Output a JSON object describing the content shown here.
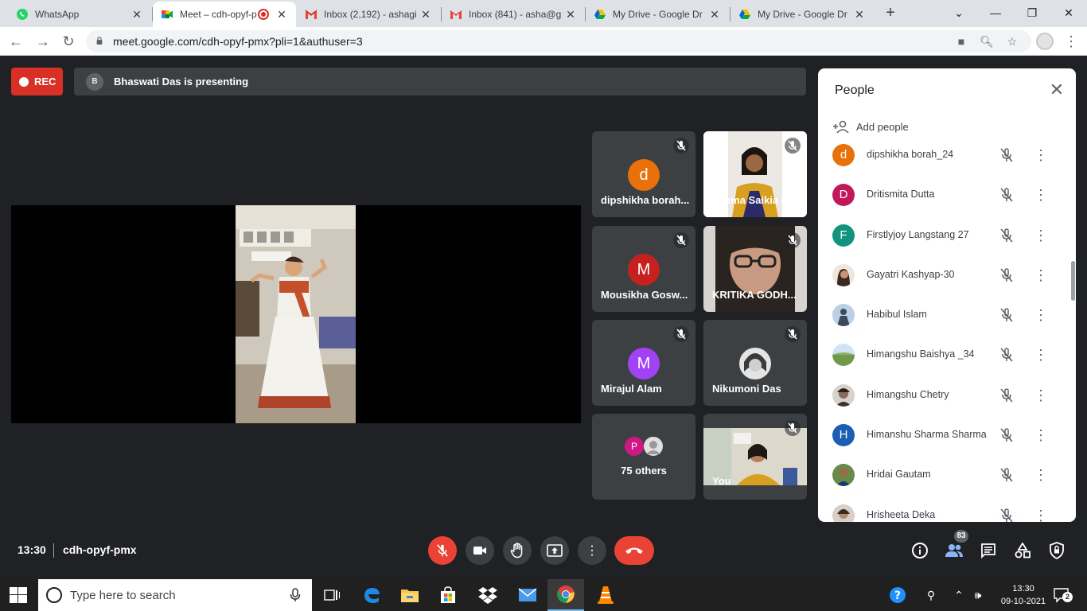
{
  "browser": {
    "tabs": [
      {
        "title": "WhatsApp",
        "icon": "whatsapp-icon"
      },
      {
        "title": "Meet – cdh-opyf-p",
        "icon": "google-meet-icon",
        "recording": true
      },
      {
        "title": "Inbox (2,192) - ashagi",
        "icon": "gmail-icon"
      },
      {
        "title": "Inbox (841) - asha@g",
        "icon": "gmail-icon"
      },
      {
        "title": "My Drive - Google Dr",
        "icon": "google-drive-icon"
      },
      {
        "title": "My Drive - Google Dr",
        "icon": "google-drive-icon"
      }
    ],
    "url": "meet.google.com/cdh-opyf-pmx?pli=1&authuser=3"
  },
  "meet": {
    "rec_label": "REC",
    "presenter": {
      "initial": "B",
      "text": "Bhaswati Das is presenting"
    },
    "tiles": [
      {
        "name": "dipshikha borah...",
        "initial": "d",
        "color": "#e8710a",
        "type": "avatar"
      },
      {
        "name": "Seema Saikia 84",
        "type": "video"
      },
      {
        "name": "Mousikha Gosw...",
        "initial": "M",
        "color": "#c5221f",
        "type": "avatar"
      },
      {
        "name": "KRITIKA GODH...",
        "type": "video"
      },
      {
        "name": "Mirajul Alam",
        "initial": "M",
        "color": "#a142f4",
        "type": "avatar"
      },
      {
        "name": "Nikumoni Das",
        "type": "photo"
      },
      {
        "name": "75 others",
        "initial": "P",
        "color": "#d01884",
        "type": "others"
      },
      {
        "name": "You",
        "type": "video"
      }
    ],
    "meeting_time": "13:30",
    "meeting_code": "cdh-opyf-pmx",
    "participant_count": "83"
  },
  "people_panel": {
    "title": "People",
    "add_label": "Add people",
    "people": [
      {
        "name": "dipshikha borah_24",
        "initial": "d",
        "color": "#e8710a"
      },
      {
        "name": "Dritismita Dutta",
        "initial": "D",
        "color": "#c2185b"
      },
      {
        "name": "Firstlyjoy Langstang 27",
        "initial": "F",
        "color": "#12937b"
      },
      {
        "name": "Gayatri Kashyap-30",
        "initial": "",
        "color": "#b08d7a"
      },
      {
        "name": "Habibul Islam",
        "initial": "",
        "color": "#6f8fb0"
      },
      {
        "name": "Himangshu Baishya _34",
        "initial": "",
        "color": "#7aa35a"
      },
      {
        "name": "Himangshu Chetry",
        "initial": "",
        "color": "#8a7a70"
      },
      {
        "name": "Himanshu Sharma Sharma",
        "initial": "H",
        "color": "#1a5fb4"
      },
      {
        "name": "Hridai Gautam",
        "initial": "",
        "color": "#5a6e3c"
      },
      {
        "name": "Hrisheeta Deka",
        "initial": "",
        "color": "#9b7d6a"
      }
    ]
  },
  "taskbar": {
    "search_placeholder": "Type here to search",
    "time": "13:30",
    "date": "09-10-2021",
    "notification_count": "2"
  }
}
